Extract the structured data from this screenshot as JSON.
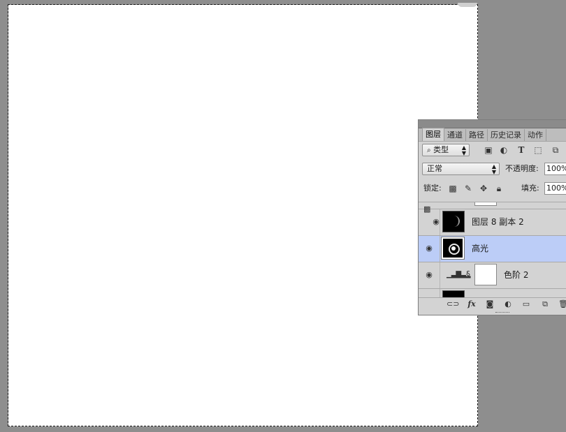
{
  "panel": {
    "tabs": [
      "图层",
      "通道",
      "路径",
      "历史记录",
      "动作"
    ],
    "active_tab_index": 0,
    "filter": {
      "icon": "search-icon",
      "value": "类型"
    },
    "filter_icons": [
      "image-filter-icon",
      "adjustment-filter-icon",
      "type-filter-icon",
      "shape-filter-icon",
      "smart-object-filter-icon"
    ],
    "blend_mode": "正常",
    "opacity_label": "不透明度:",
    "opacity_value": "100%",
    "lock_label": "锁定:",
    "lock_icons": [
      "lock-transparent-icon",
      "lock-image-icon",
      "lock-position-icon",
      "lock-all-icon"
    ],
    "fill_label": "填充:",
    "fill_value": "100%",
    "layers": [
      {
        "name": "图层 8 副本 2",
        "visible": true,
        "selected": false,
        "clipped": true
      },
      {
        "name": "高光",
        "visible": true,
        "selected": true,
        "clipped": false
      },
      {
        "name": "色阶 2",
        "visible": true,
        "selected": false,
        "adjustment": "levels-icon"
      }
    ],
    "footer_icons": [
      "link-layers-icon",
      "fx-icon",
      "add-mask-icon",
      "new-adjustment-icon",
      "new-group-icon",
      "new-layer-icon",
      "delete-layer-icon"
    ],
    "fx_label": "fx"
  }
}
